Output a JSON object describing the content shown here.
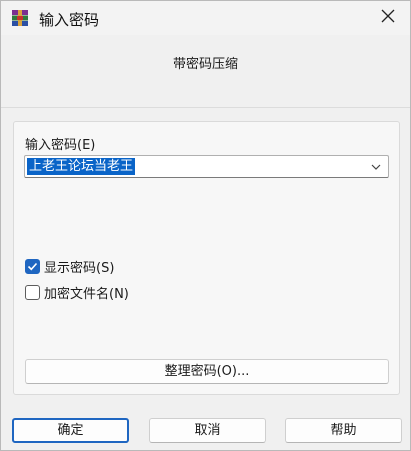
{
  "window": {
    "title": "输入密码",
    "icon": "winrar-icon",
    "close_icon": "close-icon"
  },
  "header": {
    "caption": "带密码压缩"
  },
  "password": {
    "label": "输入密码(E)",
    "value": "上老王论坛当老王",
    "dropdown_icon": "chevron-down-icon"
  },
  "options": {
    "show_password": {
      "label": "显示密码(S)",
      "checked": true
    },
    "encrypt_filenames": {
      "label": "加密文件名(N)",
      "checked": false
    }
  },
  "organize_button": {
    "label": "整理密码(O)..."
  },
  "buttons": {
    "ok": "确定",
    "cancel": "取消",
    "help": "帮助"
  },
  "colors": {
    "accent": "#1f66c1",
    "selection": "#0a64c8",
    "background": "#f0f0f0"
  }
}
